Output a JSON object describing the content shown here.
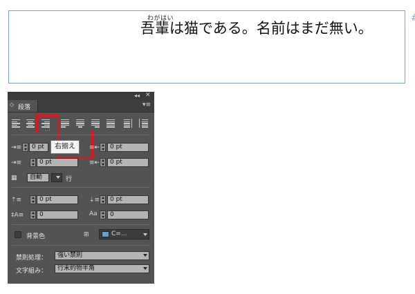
{
  "document": {
    "ruby": "わがはい",
    "story": "吾輩は猫である。名前はまだ無い。",
    "overset_mark": "#"
  },
  "panel": {
    "collapse_glyph": "◂◂",
    "close_glyph": "✕",
    "tab": {
      "chevron_glyph": "◇",
      "label": "段落"
    },
    "menu_glyph": "▾≡",
    "alignment_buttons": [
      {
        "id": "align-left"
      },
      {
        "id": "align-center"
      },
      {
        "id": "align-right"
      },
      {
        "id": "align-left-justify"
      },
      {
        "id": "align-center-justify"
      },
      {
        "id": "align-right-justify"
      },
      {
        "id": "justify-all"
      },
      {
        "id": "align-towards-spine"
      },
      {
        "id": "align-away-from-spine"
      }
    ],
    "tooltip": "右揃え",
    "fields": {
      "left_indent": "0 pt",
      "right_indent": "0 pt",
      "first_line_indent": "0 pt",
      "last_line_right_indent": "0 pt",
      "space_before": "0 pt",
      "space_after": "0 pt",
      "drop_cap_lines": "0",
      "drop_cap_chars": "0"
    },
    "grid": {
      "value": "自動",
      "unit_label": "行"
    },
    "shading": {
      "label": "背景色",
      "color_value": "C=...",
      "swatch_color": "#6b9fc7"
    },
    "kinsoku": {
      "label": "禁則処理：",
      "value": "強い禁則"
    },
    "mojikumi": {
      "label": "文字組み：",
      "value": "行末約物半角"
    }
  },
  "colors": {
    "selection_red": "#e0141c",
    "frame_blue": "#6f9ed6",
    "panel_bg": "#535353"
  }
}
